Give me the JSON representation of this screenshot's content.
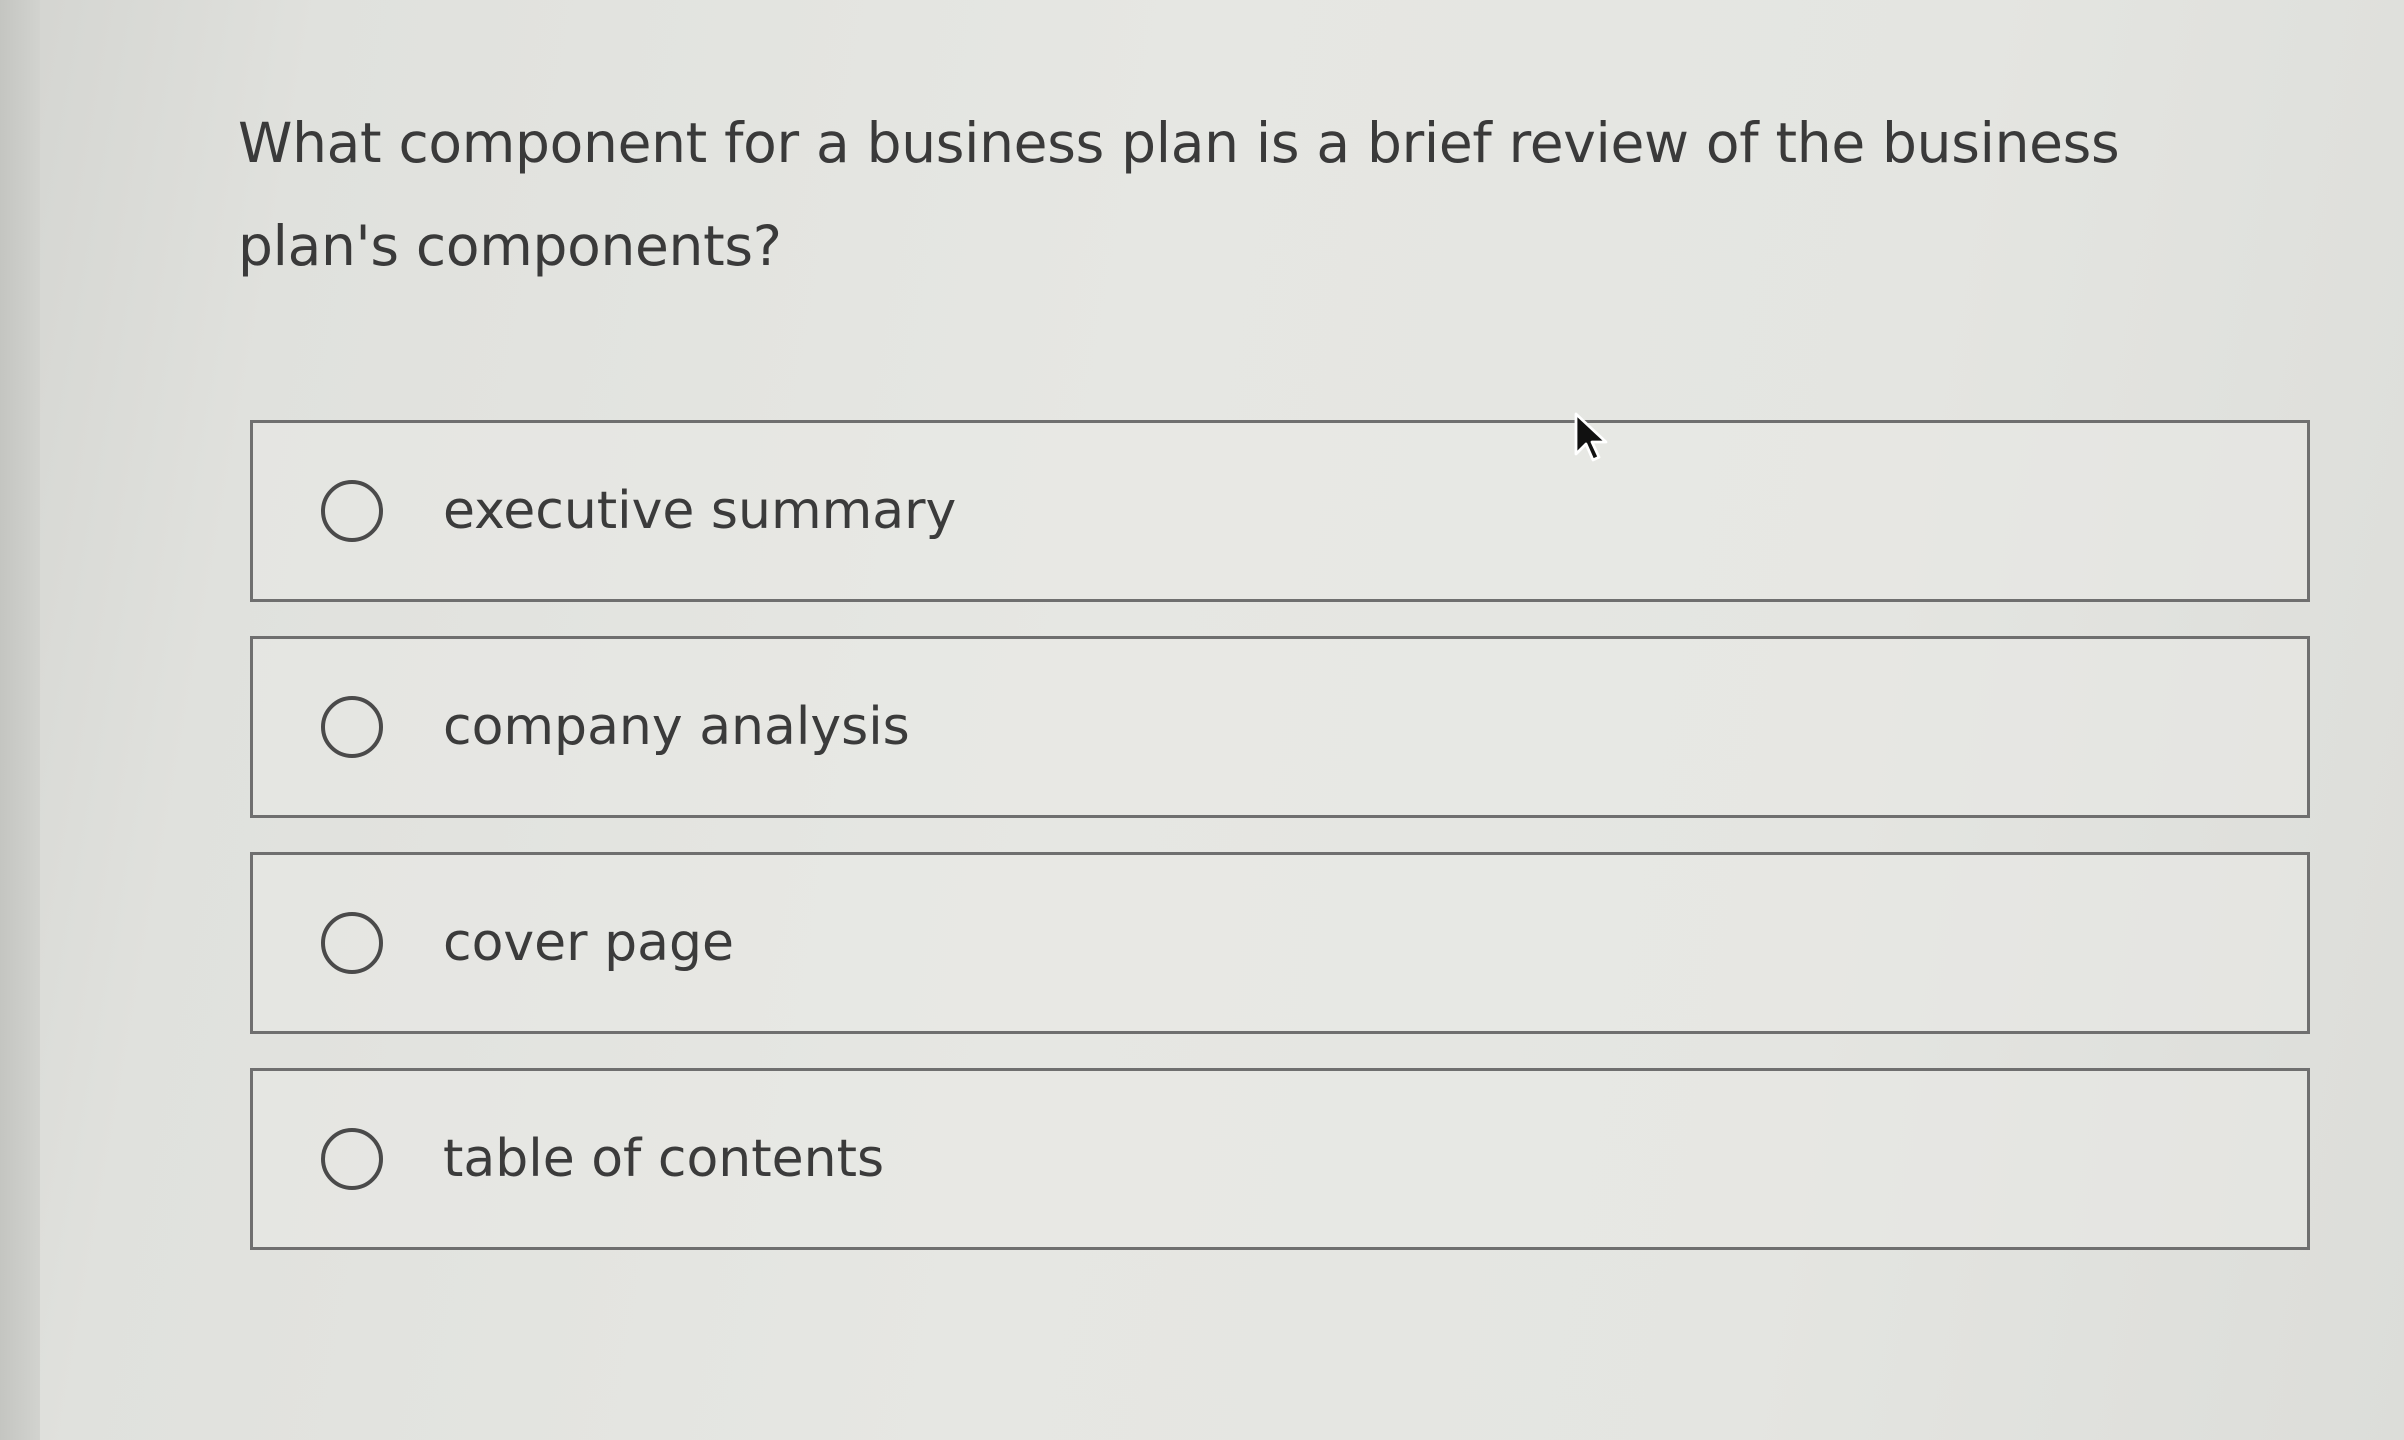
{
  "question": {
    "text": "What component for a business plan is a brief review of the business plan's components?"
  },
  "options": [
    {
      "label": "executive summary",
      "selected": false
    },
    {
      "label": "company analysis",
      "selected": false
    },
    {
      "label": "cover page",
      "selected": false
    },
    {
      "label": "table of contents",
      "selected": false
    }
  ],
  "icons": {
    "radio": "radio-unchecked-icon",
    "cursor": "mouse-pointer-icon"
  }
}
